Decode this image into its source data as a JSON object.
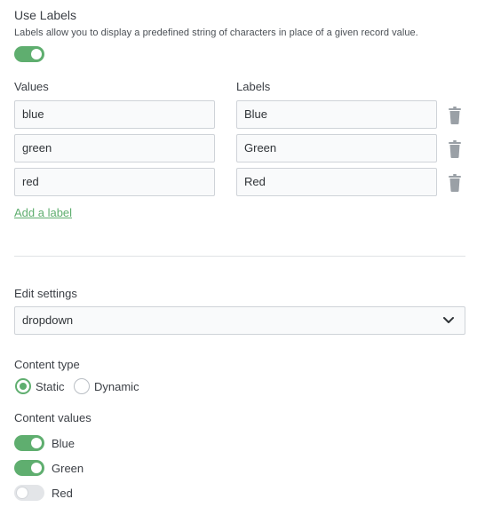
{
  "use_labels": {
    "title": "Use Labels",
    "description": "Labels allow you to display a predefined string of characters in place of a given record value.",
    "enabled": true
  },
  "mapping": {
    "values_header": "Values",
    "labels_header": "Labels",
    "rows": [
      {
        "value": "blue",
        "label": "Blue"
      },
      {
        "value": "green",
        "label": "Green"
      },
      {
        "value": "red",
        "label": "Red"
      }
    ],
    "add_label": "Add a label"
  },
  "edit_settings": {
    "label": "Edit settings",
    "selected": "dropdown"
  },
  "content_type": {
    "label": "Content type",
    "options": [
      "Static",
      "Dynamic"
    ],
    "selected": "Static"
  },
  "content_values": {
    "label": "Content values",
    "items": [
      {
        "name": "Blue",
        "enabled": true
      },
      {
        "name": "Green",
        "enabled": true
      },
      {
        "name": "Red",
        "enabled": false
      }
    ]
  },
  "colors": {
    "accent": "#5fae6f",
    "toggle_off": "#e3e5e8",
    "text": "#3b3f45",
    "border": "#cfd3d8",
    "trash": "#9aa0a6"
  }
}
